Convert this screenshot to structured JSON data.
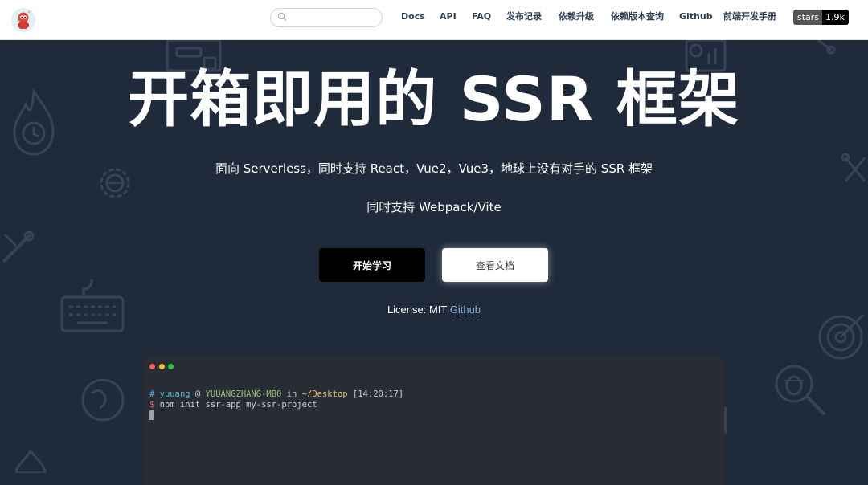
{
  "navbar": {
    "search": {
      "placeholder": "",
      "value": ""
    },
    "links": [
      {
        "label": "Docs"
      },
      {
        "label": "API"
      },
      {
        "label": "FAQ"
      },
      {
        "label": "发布记录"
      },
      {
        "label": "依赖升级"
      },
      {
        "label": "依赖版本查询"
      },
      {
        "label": "Github"
      },
      {
        "label": "前端开发手册"
      }
    ],
    "stars_badge": {
      "label": "stars",
      "count": "1.9k"
    }
  },
  "hero": {
    "title": "开箱即用的 SSR 框架",
    "subtitle": "面向 Serverless，同时支持 React，Vue2，Vue3，地球上没有对手的 SSR 框架",
    "subtitle2": "同时支持 Webpack/Vite",
    "primary_button": "开始学习",
    "secondary_button": "查看文档",
    "license_text": "License: MIT ",
    "license_link": "Github"
  },
  "terminal": {
    "hash": "#",
    "user": "yuuang",
    "at": " @ ",
    "host": "YUUANGZHANG-MB0",
    "in": " in ",
    "path": "~/Desktop",
    "time": " [14:20:17]",
    "prompt": "$",
    "command": " npm init ssr-app my-ssr-project"
  },
  "colors": {
    "background": "#1f2a3b",
    "terminal_bg": "#282c34",
    "primary_button": "#000000",
    "link": "#8fb3d9"
  }
}
